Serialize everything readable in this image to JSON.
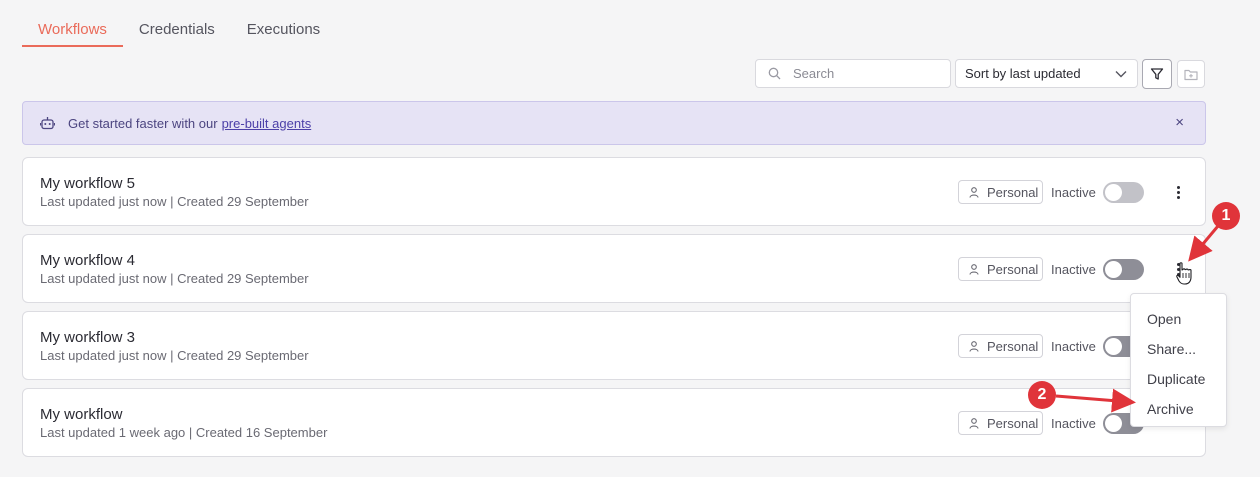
{
  "tabs": [
    {
      "label": "Workflows",
      "active": true
    },
    {
      "label": "Credentials",
      "active": false
    },
    {
      "label": "Executions",
      "active": false
    }
  ],
  "toolbar": {
    "search_placeholder": "Search",
    "sort_value": "Sort by last updated",
    "filter_icon": "filter-icon",
    "folder_icon": "folder-add-icon"
  },
  "banner": {
    "text": "Get started faster with our",
    "link": "pre-built agents",
    "close": "×",
    "icon": "robot-icon"
  },
  "workflows": [
    {
      "name": "My workflow 5",
      "meta": "Last updated just now | Created 29 September",
      "owner": "Personal",
      "status": "Inactive"
    },
    {
      "name": "My workflow 4",
      "meta": "Last updated just now | Created 29 September",
      "owner": "Personal",
      "status": "Inactive"
    },
    {
      "name": "My workflow 3",
      "meta": "Last updated just now | Created 29 September",
      "owner": "Personal",
      "status": "Inactive"
    },
    {
      "name": "My workflow",
      "meta": "Last updated 1 week ago | Created 16 September",
      "owner": "Personal",
      "status": "Inactive"
    }
  ],
  "context_menu": {
    "items": [
      "Open",
      "Share...",
      "Duplicate",
      "Archive"
    ]
  },
  "annotations": {
    "badge1": "1",
    "badge2": "2",
    "color": "#e0343a"
  },
  "colors": {
    "accent": "#ea6b5a",
    "banner_bg": "#e6e3f5",
    "banner_link": "#4c40a8"
  }
}
